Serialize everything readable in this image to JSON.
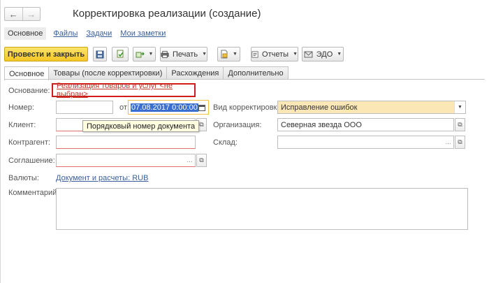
{
  "window": {
    "title": "Корректировка реализации (создание)"
  },
  "nav": {
    "back_icon": "arrow-left-icon",
    "forward_icon": "arrow-right-icon"
  },
  "sections": [
    "Основное",
    "Файлы",
    "Задачи",
    "Мои заметки"
  ],
  "toolbar": {
    "post_close": "Провести и закрыть",
    "print": "Печать",
    "reports": "Отчеты",
    "edo": "ЭДО"
  },
  "tabs": [
    "Основное",
    "Товары (после корректировки)",
    "Расхождения",
    "Дополнительно"
  ],
  "form": {
    "basis_label": "Основание:",
    "basis_link": "Реализация товаров и услуг <не выбран>",
    "number_label": "Номер:",
    "number_value": "",
    "from_label": "от:",
    "date_value": "07.08.2017  0:00:00",
    "adj_type_label": "Вид корректировки:",
    "adj_type_value": "Исправление ошибок",
    "client_label": "Клиент:",
    "client_value": "",
    "org_label": "Организация:",
    "org_value": "Северная звезда ООО",
    "counterparty_label": "Контрагент:",
    "counterparty_value": "",
    "warehouse_label": "Склад:",
    "warehouse_value": "",
    "agreement_label": "Соглашение:",
    "agreement_value": "",
    "currency_label": "Валюты:",
    "currency_link": "Документ и расчеты: RUB",
    "comment_label": "Комментарий:",
    "comment_value": ""
  },
  "tooltip": "Порядковый номер документа",
  "colors": {
    "primary_button": "#f4c625",
    "link": "#3a5f9c",
    "highlight_border": "#d11c1c",
    "adj_type_bg": "#fbe6b5",
    "date_focus_border": "#f0c040",
    "tooltip_bg": "#fffde0"
  }
}
